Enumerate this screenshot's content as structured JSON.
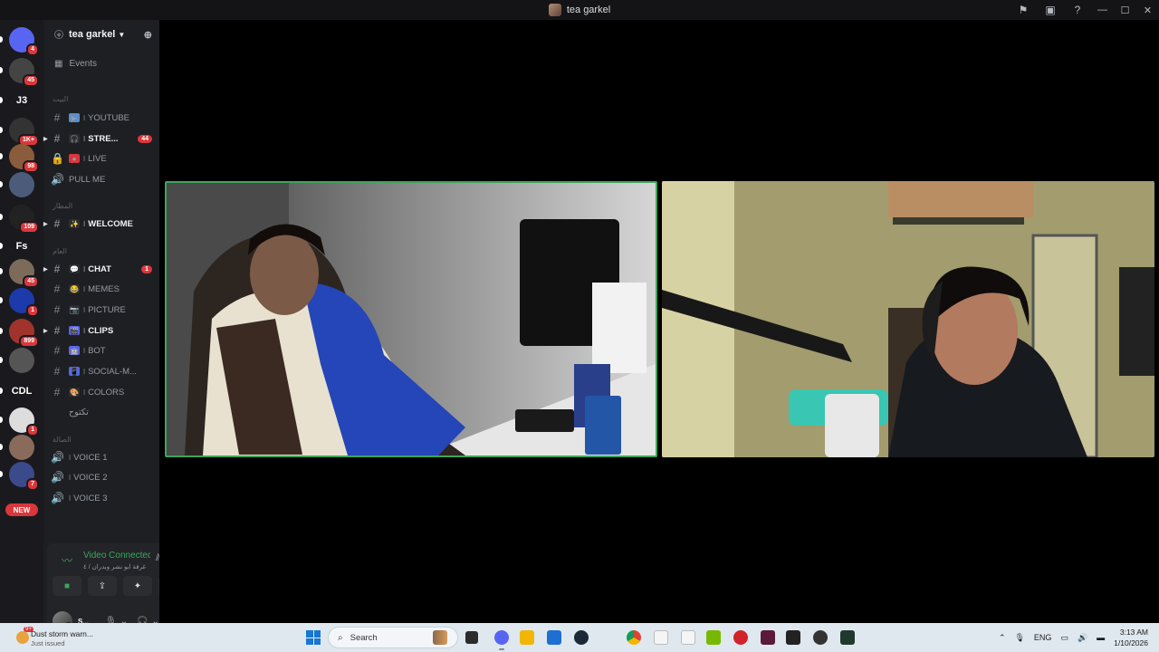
{
  "window": {
    "title": "tea garkel",
    "controls": {
      "minimize": "—",
      "maximize": "☐",
      "close": "✕"
    }
  },
  "guild_rail": {
    "servers": [
      {
        "label": "",
        "badge": "4",
        "color": "#5865f2"
      },
      {
        "label": "",
        "badge": "45",
        "color": "#444"
      },
      {
        "label": "J3",
        "badge": "",
        "color": "#1a1a1e"
      },
      {
        "label": "",
        "badge": "1K+",
        "color": "#333"
      },
      {
        "label": "",
        "badge": "98",
        "color": "#8a5c3c"
      },
      {
        "label": "",
        "badge": "",
        "color": "#4a5c7a"
      },
      {
        "label": "",
        "badge": "109",
        "color": "#222"
      },
      {
        "label": "Fs",
        "badge": "",
        "color": "#1a1a1e"
      },
      {
        "label": "",
        "badge": "45",
        "color": "#7c6b5a"
      },
      {
        "label": "",
        "badge": "1",
        "color": "#1c3aa9"
      },
      {
        "label": "",
        "badge": "899",
        "color": "#a0342c"
      },
      {
        "label": "",
        "badge": "",
        "color": "#555"
      },
      {
        "label": "CDL",
        "badge": "",
        "color": "#1a1a1e"
      },
      {
        "label": "",
        "badge": "1",
        "color": "#ddd"
      },
      {
        "label": "",
        "badge": "",
        "color": "#8a6a5a"
      },
      {
        "label": "",
        "badge": "7",
        "color": "#3a4a8a"
      }
    ],
    "new_label": "NEW"
  },
  "sidebar": {
    "server_name": "tea garkel",
    "events_label": "Events",
    "categories": [
      "البيت",
      "المطار",
      "العام",
      "الصالة"
    ],
    "channels": [
      {
        "name": "YOUTUBE",
        "emoji": "▶",
        "emoji_color": "#5b8fc9",
        "kind": "text",
        "unread": false,
        "badge": ""
      },
      {
        "name": "STRE...",
        "emoji": "🎧",
        "emoji_color": "#2b2d31",
        "kind": "text",
        "unread": true,
        "badge": "44"
      },
      {
        "name": "LIVE",
        "emoji": "●",
        "emoji_color": "#da373c",
        "kind": "locked",
        "unread": false,
        "badge": ""
      },
      {
        "name": "PULL ME",
        "emoji": "",
        "emoji_color": "",
        "kind": "voice",
        "unread": false,
        "badge": ""
      },
      {
        "name": "WELCOME",
        "emoji": "✨",
        "emoji_color": "#2b2d31",
        "kind": "text",
        "unread": true,
        "badge": ""
      },
      {
        "name": "CHAT",
        "emoji": "💬",
        "emoji_color": "#2b2d31",
        "kind": "text",
        "unread": true,
        "badge": "1"
      },
      {
        "name": "MEMES",
        "emoji": "😂",
        "emoji_color": "#2b2d31",
        "kind": "text",
        "unread": false,
        "badge": ""
      },
      {
        "name": "PICTURE",
        "emoji": "📷",
        "emoji_color": "#2b2d31",
        "kind": "text",
        "unread": false,
        "badge": ""
      },
      {
        "name": "CLIPS",
        "emoji": "🎬",
        "emoji_color": "#5865f2",
        "kind": "text",
        "unread": true,
        "badge": ""
      },
      {
        "name": "BOT",
        "emoji": "🤖",
        "emoji_color": "#5865f2",
        "kind": "text",
        "unread": false,
        "badge": ""
      },
      {
        "name": "SOCIAL-M...",
        "emoji": "📱",
        "emoji_color": "#5865f2",
        "kind": "text",
        "unread": false,
        "badge": ""
      },
      {
        "name": "COLORS",
        "emoji": "🎨",
        "emoji_color": "#2b2d31",
        "kind": "text",
        "unread": false,
        "badge": ""
      },
      {
        "name": "تكتوح",
        "emoji": "",
        "emoji_color": "",
        "kind": "plain",
        "unread": false,
        "badge": ""
      },
      {
        "name": "VOICE 1",
        "emoji": "🔊",
        "emoji_color": "#2b2d31",
        "kind": "voice",
        "unread": false,
        "badge": ""
      },
      {
        "name": "VOICE 2",
        "emoji": "🔊",
        "emoji_color": "#2b2d31",
        "kind": "voice",
        "unread": false,
        "badge": ""
      },
      {
        "name": "VOICE 3",
        "emoji": "🔊",
        "emoji_color": "#2b2d31",
        "kind": "voice",
        "unread": false,
        "badge": ""
      }
    ]
  },
  "voice_panel": {
    "status": "Video Connected",
    "channel": "غرفة ابو نشر وبدران / ٤"
  },
  "user_panel": {
    "name": "S..."
  },
  "taskbar": {
    "weather_title": "Dust storm warn...",
    "weather_sub": "Just issued",
    "weather_badge": "9+",
    "search_placeholder": "Search",
    "lang": "ENG",
    "time": "3:13 AM",
    "date": "1/10/2026"
  },
  "colors": {
    "accent_green": "#3ba55c",
    "badge_red": "#da373c",
    "discord_blurple": "#5865f2"
  }
}
